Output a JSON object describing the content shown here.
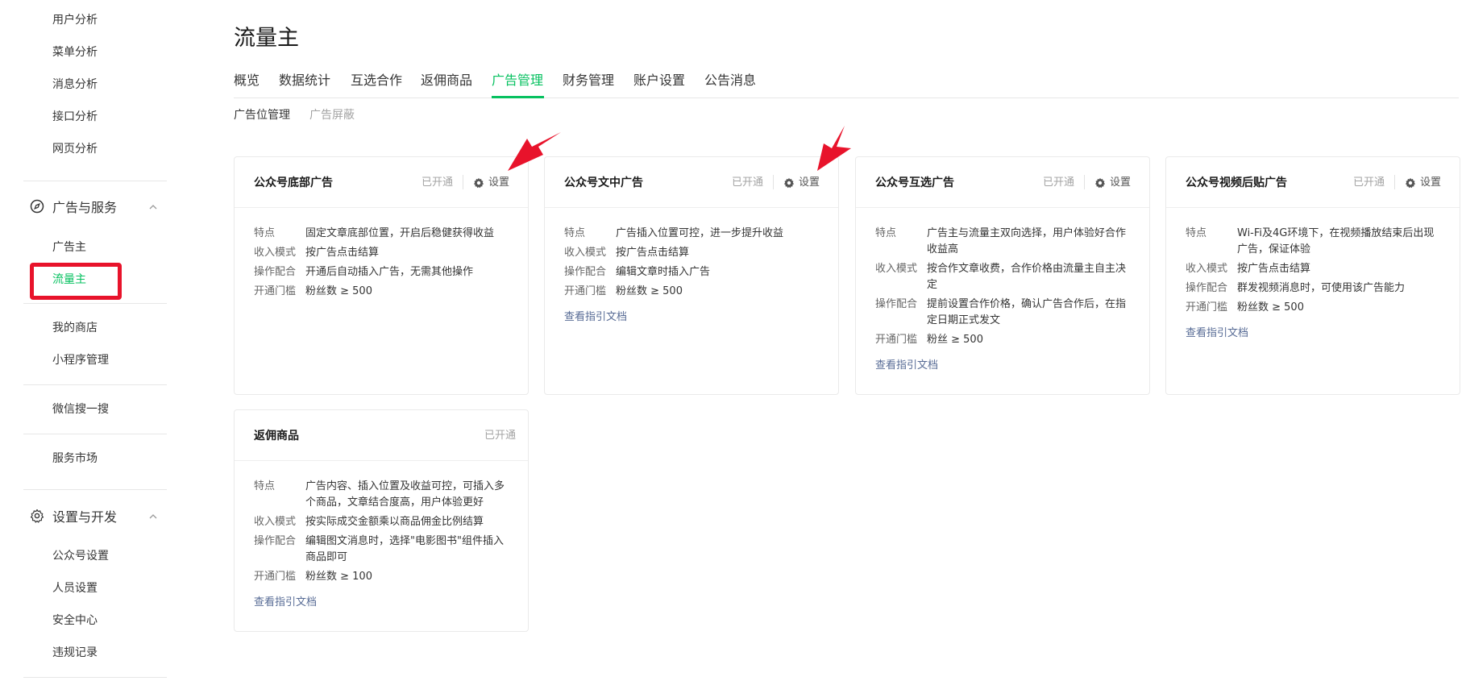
{
  "sidebar": {
    "top_items": [
      "用户分析",
      "菜单分析",
      "消息分析",
      "接口分析",
      "网页分析"
    ],
    "group_ads": {
      "title": "广告与服务",
      "items": [
        {
          "label": "广告主",
          "active": false
        },
        {
          "label": "流量主",
          "active": true
        }
      ]
    },
    "mid_items": [
      "我的商店",
      "小程序管理"
    ],
    "item_search": "微信搜一搜",
    "item_market": "服务市场",
    "group_settings": {
      "title": "设置与开发",
      "items": [
        "公众号设置",
        "人员设置",
        "安全中心",
        "违规记录"
      ]
    }
  },
  "header": {
    "title": "流量主",
    "tabs": [
      "概览",
      "数据统计",
      "互选合作",
      "返佣商品",
      "广告管理",
      "财务管理",
      "账户设置",
      "公告消息"
    ],
    "active_tab": "广告管理",
    "subtabs": [
      "广告位管理",
      "广告屏蔽"
    ]
  },
  "cards": [
    {
      "title": "公众号底部广告",
      "status": "已开通",
      "settings_label": "设置",
      "rows": [
        {
          "k": "特点",
          "v": "固定文章底部位置，开启后稳健获得收益"
        },
        {
          "k": "收入模式",
          "v": "按广告点击结算"
        },
        {
          "k": "操作配合",
          "v": "开通后自动插入广告，无需其他操作"
        },
        {
          "k": "开通门槛",
          "v": "粉丝数 ≥ 500"
        }
      ],
      "link": ""
    },
    {
      "title": "公众号文中广告",
      "status": "已开通",
      "settings_label": "设置",
      "rows": [
        {
          "k": "特点",
          "v": "广告插入位置可控，进一步提升收益"
        },
        {
          "k": "收入模式",
          "v": "按广告点击结算"
        },
        {
          "k": "操作配合",
          "v": "编辑文章时插入广告"
        },
        {
          "k": "开通门槛",
          "v": "粉丝数 ≥ 500"
        }
      ],
      "link": "查看指引文档"
    },
    {
      "title": "公众号互选广告",
      "status": "已开通",
      "settings_label": "设置",
      "rows": [
        {
          "k": "特点",
          "v": "广告主与流量主双向选择，用户体验好合作收益高"
        },
        {
          "k": "收入模式",
          "v": "按合作文章收费，合作价格由流量主自主决定"
        },
        {
          "k": "操作配合",
          "v": "提前设置合作价格，确认广告合作后，在指定日期正式发文"
        },
        {
          "k": "开通门槛",
          "v": "粉丝 ≥ 500"
        }
      ],
      "link": "查看指引文档"
    },
    {
      "title": "公众号视频后贴广告",
      "status": "已开通",
      "settings_label": "设置",
      "rows": [
        {
          "k": "特点",
          "v": "Wi-Fi及4G环境下，在视频播放结束后出现广告，保证体验"
        },
        {
          "k": "收入模式",
          "v": "按广告点击结算"
        },
        {
          "k": "操作配合",
          "v": "群发视频消息时，可使用该广告能力"
        },
        {
          "k": "开通门槛",
          "v": "粉丝数 ≥ 500"
        }
      ],
      "link": "查看指引文档"
    },
    {
      "title": "返佣商品",
      "status": "已开通",
      "rows": [
        {
          "k": "特点",
          "v": "广告内容、插入位置及收益可控，可插入多个商品，文章结合度高，用户体验更好"
        },
        {
          "k": "收入模式",
          "v": "按实际成交金额乘以商品佣金比例结算"
        },
        {
          "k": "操作配合",
          "v": "编辑图文消息时，选择\"电影图书\"组件插入商品即可"
        },
        {
          "k": "开通门槛",
          "v": "粉丝数 ≥ 100"
        }
      ],
      "link": "查看指引文档"
    }
  ],
  "colors": {
    "accent": "#07c160",
    "link": "#576b95",
    "annotation_red": "#e8132b"
  }
}
